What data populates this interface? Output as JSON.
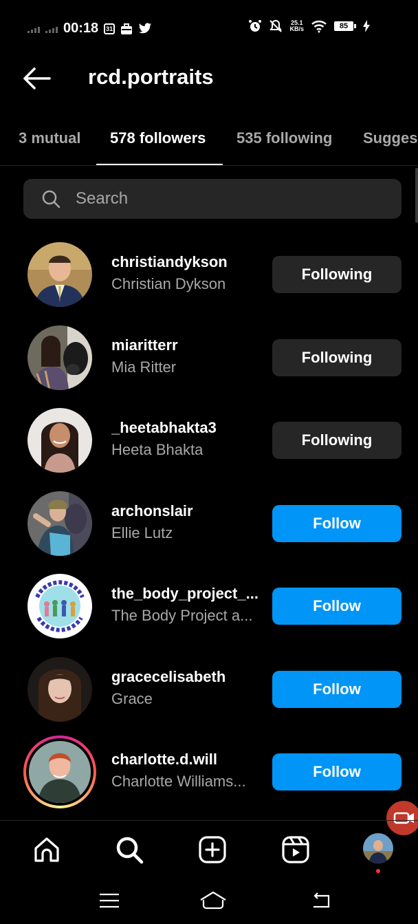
{
  "status_bar": {
    "time": "00:18",
    "speed_value": "25.1",
    "speed_unit": "KB/s",
    "battery": "85"
  },
  "header": {
    "title": "rcd.portraits"
  },
  "tabs": [
    {
      "label": "3 mutual",
      "active": false
    },
    {
      "label": "578 followers",
      "active": true
    },
    {
      "label": "535 following",
      "active": false
    },
    {
      "label": "Sugges",
      "active": false
    }
  ],
  "search": {
    "placeholder": "Search"
  },
  "users": [
    {
      "username": "christiandykson",
      "name": "Christian Dykson",
      "button": "Following"
    },
    {
      "username": "miaritterr",
      "name": "Mia Ritter",
      "button": "Following"
    },
    {
      "username": "_heetabhakta3",
      "name": "Heeta Bhakta",
      "button": "Following"
    },
    {
      "username": "archonslair",
      "name": "Ellie Lutz",
      "button": "Follow"
    },
    {
      "username": "the_body_project_...",
      "name": "The Body Project a...",
      "button": "Follow"
    },
    {
      "username": "gracecelisabeth",
      "name": "Grace",
      "button": "Follow"
    },
    {
      "username": "charlotte.d.will",
      "name": "Charlotte Williams...",
      "button": "Follow"
    }
  ],
  "colors": {
    "accent": "#0095f6",
    "secondary_button": "#262626",
    "muted_text": "#a8a8a8"
  },
  "icons": {
    "nav": [
      "home-icon",
      "search-icon",
      "create-icon",
      "reels-icon",
      "profile-avatar"
    ]
  }
}
